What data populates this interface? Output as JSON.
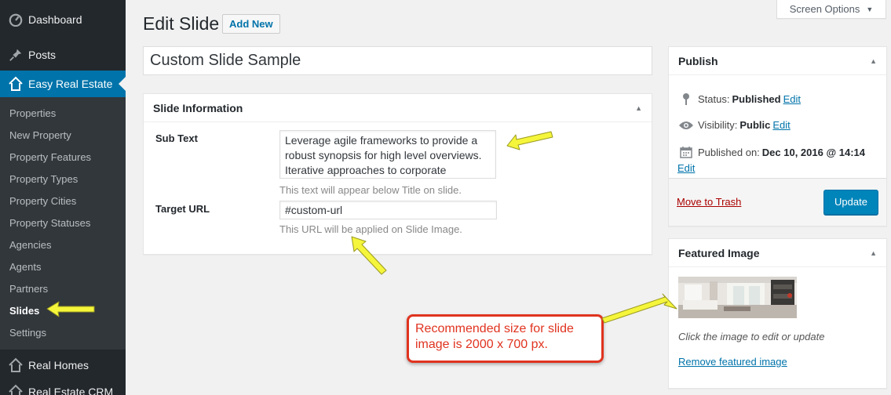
{
  "sidebar": {
    "top_items": [
      {
        "label": "Dashboard",
        "icon": "dashboard-icon"
      },
      {
        "label": "Posts",
        "icon": "pin-icon"
      },
      {
        "label": "Easy Real Estate",
        "icon": "house-icon"
      }
    ],
    "submenu": [
      "Properties",
      "New Property",
      "Property Features",
      "Property Types",
      "Property Cities",
      "Property Statuses",
      "Agencies",
      "Agents",
      "Partners",
      "Slides",
      "Settings"
    ],
    "bottom_items": [
      {
        "label": "Real Homes",
        "icon": "house-icon"
      },
      {
        "label": "Real Estate CRM",
        "icon": "house-icon"
      }
    ]
  },
  "header": {
    "screen_options": "Screen Options",
    "title": "Edit Slide",
    "add_new": "Add New"
  },
  "post_title": "Custom Slide Sample",
  "slide_info": {
    "title": "Slide Information",
    "subtext_label": "Sub Text",
    "subtext_value": "Leverage agile frameworks to provide a robust synopsis for high level overviews. Iterative approaches to corporate",
    "subtext_desc": "This text will appear below Title on slide.",
    "url_label": "Target URL",
    "url_value": "#custom-url",
    "url_desc": "This URL will be applied on Slide Image."
  },
  "publish": {
    "title": "Publish",
    "status_label": "Status:",
    "status_value": "Published",
    "visibility_label": "Visibility:",
    "visibility_value": "Public",
    "published_label": "Published on:",
    "published_value": "Dec 10, 2016 @ 14:14",
    "edit": "Edit",
    "trash": "Move to Trash",
    "update": "Update"
  },
  "featured": {
    "title": "Featured Image",
    "desc": "Click the image to edit or update",
    "remove": "Remove featured image"
  },
  "callout": "Recommended size for slide image is 2000 x 700 px.",
  "colors": {
    "sidebar_bg": "#23282d",
    "accent": "#0073aa",
    "annotation_red": "#e0331f",
    "arrow_yellow": "#f5f53b"
  }
}
